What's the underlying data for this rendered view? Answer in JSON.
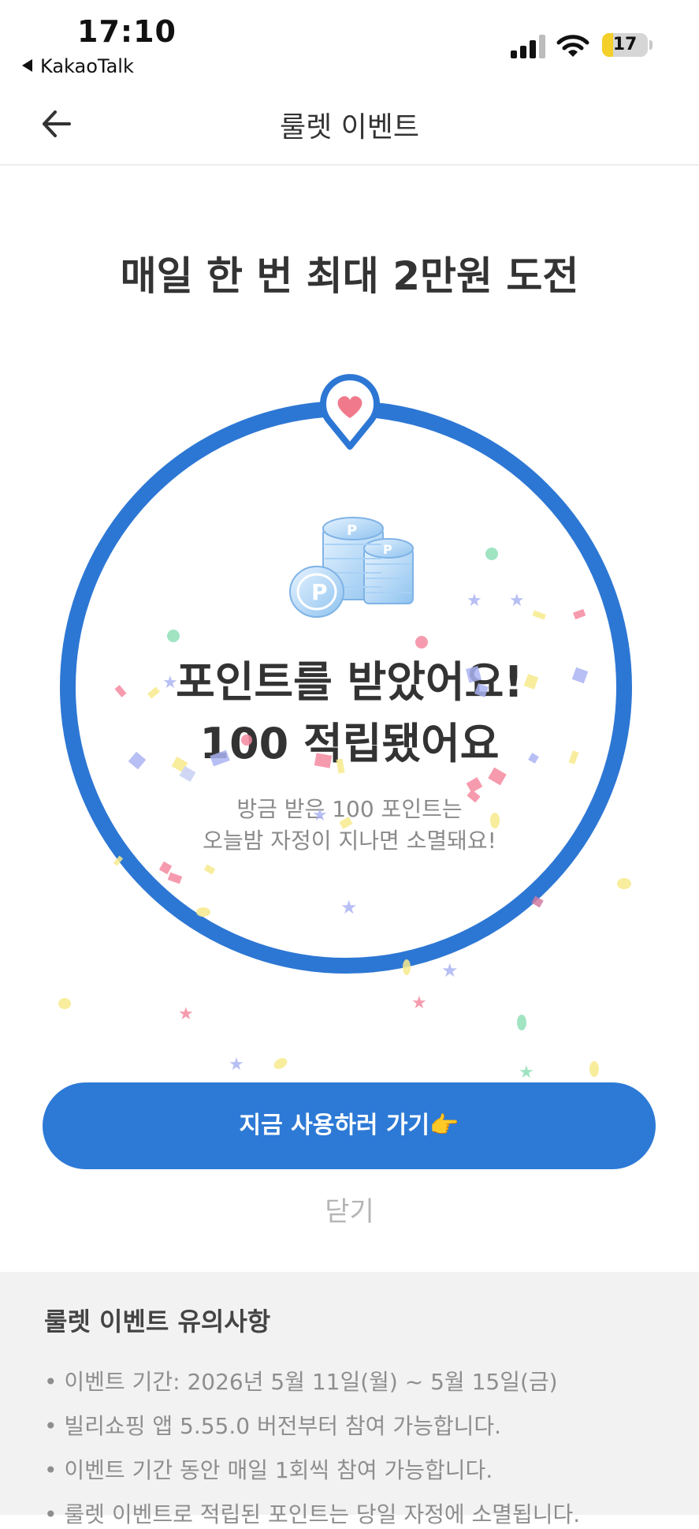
{
  "status_bar": {
    "time": "17:10",
    "back_app": "KakaoTalk",
    "battery_level": "17",
    "icons": [
      "cellular-signal-icon",
      "wifi-icon",
      "battery-icon"
    ]
  },
  "header": {
    "title": "룰렛 이벤트",
    "back_icon": "arrow-left-icon"
  },
  "headline": "매일 한 번 최대 2만원 도전",
  "result": {
    "line1": "포인트를 받았어요!",
    "line2": "100 적립됐어요",
    "notice_line1": "방금 받은 100 포인트는",
    "notice_line2": "오늘밤 자정이 지나면 소멸돼요!"
  },
  "buttons": {
    "use_now": "지금 사용하러 가기👉",
    "close": "닫기"
  },
  "notes": {
    "title": "룰렛 이벤트 유의사항",
    "items": [
      "• 이벤트 기간: 2026년 5월 11일(월) ~ 5월 15일(금)",
      "• 빌리쇼핑 앱 5.55.0 버전부터 참여 가능합니다.",
      "• 이벤트 기간 동안 매일 1회씩 참여 가능합니다.",
      "• 룰렛 이벤트로 적립된 포인트는 당일 자정에 소멸됩니다."
    ]
  },
  "colors": {
    "accent": "#2d7ad6",
    "ring": "#2d77d4",
    "pin_heart": "#f07a8c",
    "notes_bg": "#f2f2f2"
  }
}
